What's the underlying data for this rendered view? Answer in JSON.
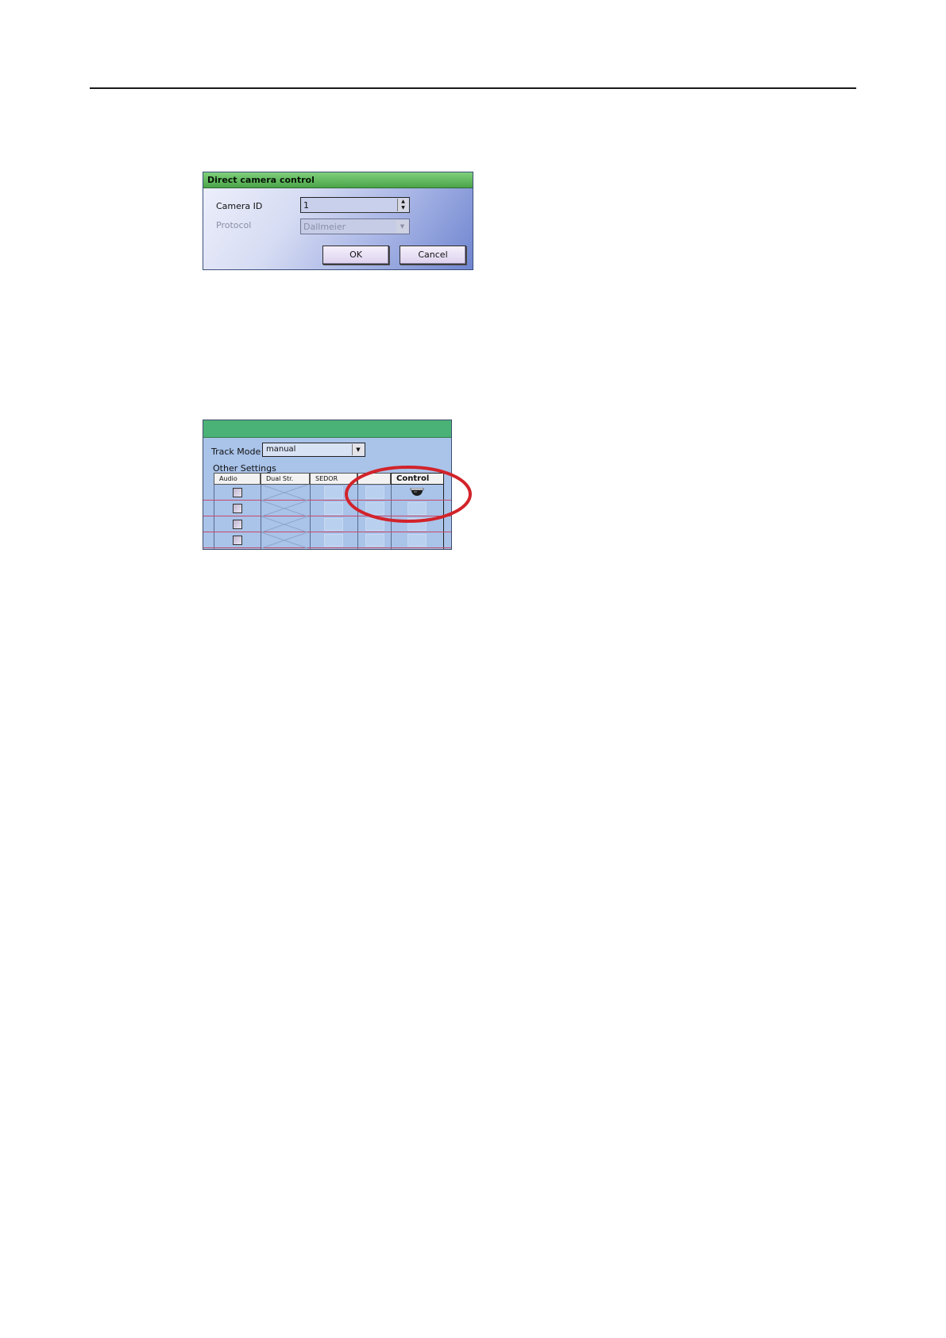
{
  "dialog": {
    "title": "Direct camera control",
    "camera_id_label": "Camera ID",
    "camera_id_value": "1",
    "protocol_label": "Protocol",
    "protocol_value": "Dallmeier",
    "ok_label": "OK",
    "cancel_label": "Cancel"
  },
  "panel": {
    "track_mode_label": "Track Mode",
    "track_mode_value": "manual",
    "other_settings_label": "Other Settings",
    "columns": {
      "audio": "Audio",
      "dual": "Dual Str.",
      "sedor": "SEDOR",
      "control": "Control"
    },
    "highlight_color": "#d2232a",
    "title_bar_color": "#4bb277"
  }
}
